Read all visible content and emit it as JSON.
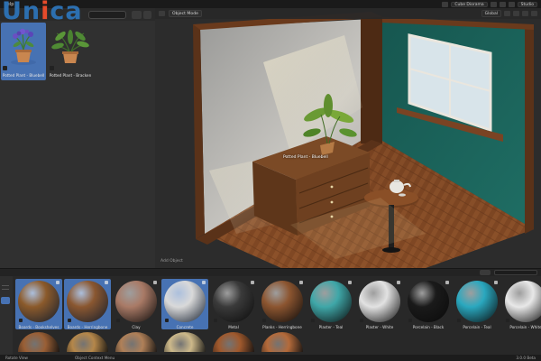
{
  "brand": {
    "dark_text": "Un",
    "accent_text": "i",
    "tail_text": "ca",
    "subtitle": ""
  },
  "topbar": {
    "menus": [
      "Help",
      "",
      "",
      ""
    ],
    "scene_name": "Cube Diorama",
    "workspace": "Studio"
  },
  "asset_browser": {
    "assets": [
      {
        "label": "Potted Plant - Bluebell",
        "selected": true
      },
      {
        "label": "Potted Plant - Bracken",
        "selected": false
      }
    ]
  },
  "viewport": {
    "mode": "Object Mode",
    "orientation": "Global",
    "object_label": "Potted Plant - Bluebell",
    "add_object_hint": "Add Object"
  },
  "material_library": {
    "materials": [
      {
        "label": "Boards - Bookshelves",
        "selected": true,
        "color": "#8b5a2b"
      },
      {
        "label": "Boards - Herringbone",
        "selected": true,
        "color": "#8a5730"
      },
      {
        "label": "Clay",
        "selected": false,
        "color": "#a97a66"
      },
      {
        "label": "Concrete",
        "selected": true,
        "color": "#d9d9d9"
      },
      {
        "label": "Metal",
        "selected": false,
        "color": "#3a3a3a"
      },
      {
        "label": "Planks - Herringbone",
        "selected": false,
        "color": "#8c5530"
      },
      {
        "label": "Plaster - Teal",
        "selected": false,
        "color": "#3fa7a8"
      },
      {
        "label": "Plaster - White",
        "selected": false,
        "color": "#e2e2e2"
      },
      {
        "label": "Porcelain - Black",
        "selected": false,
        "color": "#1a1a1a"
      },
      {
        "label": "Porcelain - Teal",
        "selected": false,
        "color": "#2aa8bf"
      },
      {
        "label": "Porcelain - White",
        "selected": false,
        "color": "#e8e8e8"
      }
    ],
    "row2_colors": [
      "#9a5f35",
      "#b5874a",
      "#b08058",
      "#cdb98a",
      "#a0592d",
      "#b46a3a"
    ]
  },
  "statusbar": {
    "left": "Rotate View",
    "middle": "Object Context Menu",
    "right": "3.0.0 Beta"
  }
}
